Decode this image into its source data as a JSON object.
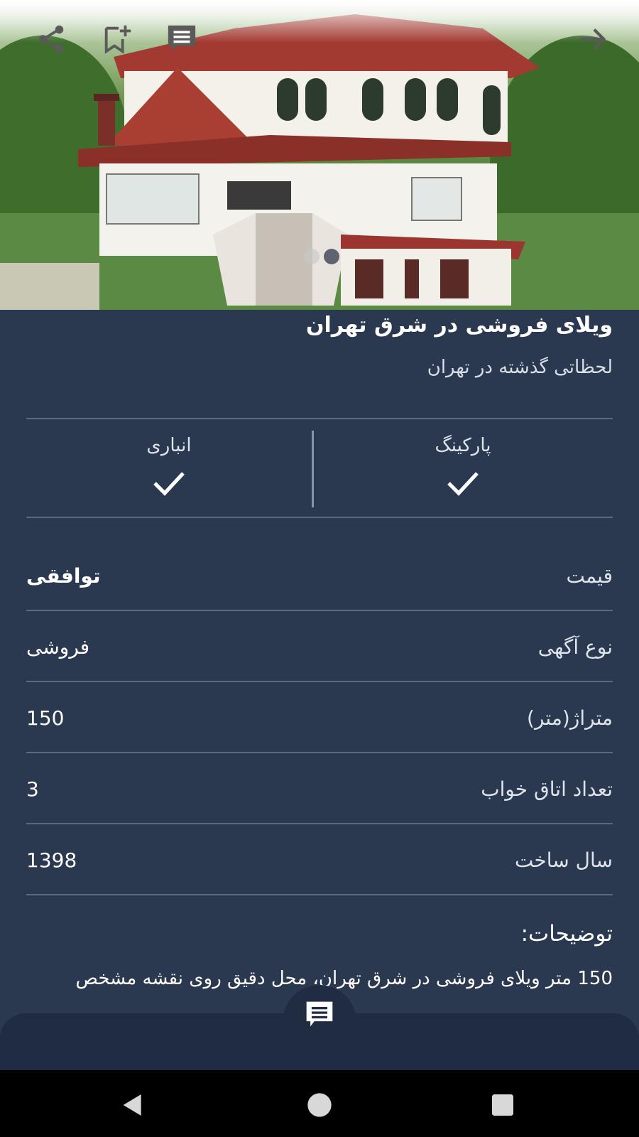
{
  "toolbar": {
    "icons": [
      "share-icon",
      "bookmark-add-icon",
      "chat-icon",
      "arrow-forward-icon"
    ]
  },
  "gallery": {
    "image": "villa-photo",
    "page_count": 2,
    "current_page": 2
  },
  "listing": {
    "title": "ویلای فروشی در شرق تهران",
    "subtitle": "لحظاتی گذشته در تهران"
  },
  "features": [
    {
      "label": "پارکینگ",
      "available": true
    },
    {
      "label": "انباری",
      "available": true
    }
  ],
  "details": [
    {
      "label": "قیمت",
      "value": "توافقی"
    },
    {
      "label": "نوع آگهی",
      "value": "فروشی"
    },
    {
      "label": "متراژ(متر)",
      "value": "150"
    },
    {
      "label": "تعداد اتاق خواب",
      "value": "3"
    },
    {
      "label": "سال ساخت",
      "value": "1398"
    }
  ],
  "description": {
    "heading": "توضیحات:",
    "text": "150 متر ویلای فروشی در شرق تهران، محل دقیق روی نقشه مشخص"
  },
  "fab": {
    "icon": "chat-icon"
  },
  "system_nav": {
    "icons": [
      "back-icon",
      "home-icon",
      "recents-icon"
    ]
  },
  "colors": {
    "background": "#2a3850",
    "bottom_bar": "#202c41",
    "divider": "#5a6880",
    "text": "#ffffff"
  }
}
